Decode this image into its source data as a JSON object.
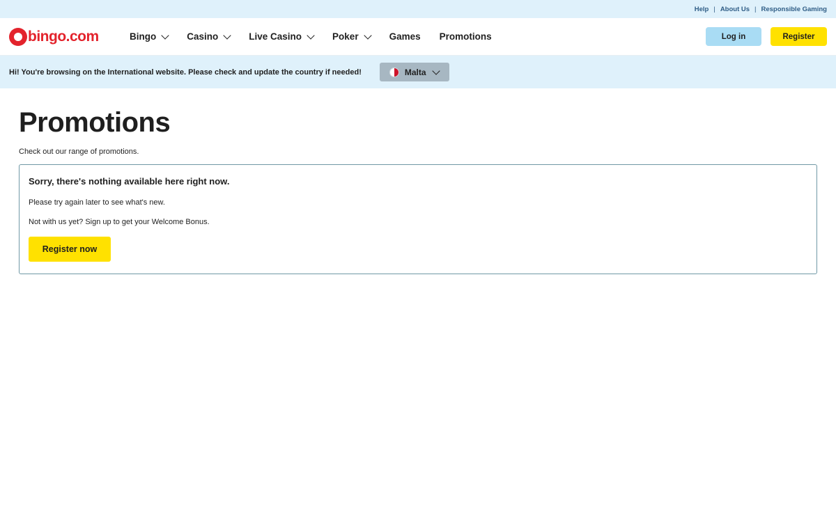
{
  "utility": {
    "links": [
      "Help",
      "About Us",
      "Responsible Gaming"
    ],
    "separator": "|"
  },
  "header": {
    "logo_text": "bingo.com",
    "nav": [
      {
        "label": "Bingo",
        "has_dropdown": true
      },
      {
        "label": "Casino",
        "has_dropdown": true
      },
      {
        "label": "Live Casino",
        "has_dropdown": true
      },
      {
        "label": "Poker",
        "has_dropdown": true
      },
      {
        "label": "Games",
        "has_dropdown": false
      },
      {
        "label": "Promotions",
        "has_dropdown": false
      }
    ],
    "login_label": "Log in",
    "register_label": "Register"
  },
  "banner": {
    "text": "Hi! You're browsing on the International website. Please check and update the country if needed!",
    "country": "Malta",
    "flag_icon": "malta-flag-icon"
  },
  "main": {
    "title": "Promotions",
    "subtitle": "Check out our range of promotions.",
    "notice": {
      "heading": "Sorry, there's nothing available here right now.",
      "line1": "Please try again later to see what's new.",
      "line2": "Not with us yet? Sign up to get your Welcome Bonus.",
      "cta_label": "Register now"
    }
  },
  "colors": {
    "brand_red": "#e3232c",
    "accent_yellow": "#ffe100",
    "light_blue": "#dff1fb",
    "login_blue": "#a9dcf4"
  }
}
